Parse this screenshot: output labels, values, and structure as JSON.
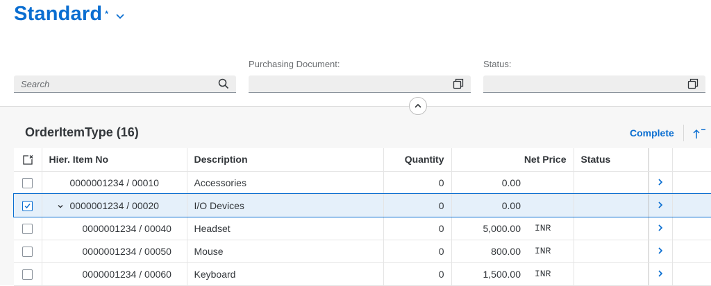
{
  "header": {
    "title": "Standard",
    "modified_marker": "*"
  },
  "filters": {
    "search": {
      "placeholder": "Search",
      "value": ""
    },
    "purchasing_document": {
      "label": "Purchasing Document:",
      "value": ""
    },
    "status": {
      "label": "Status:",
      "value": ""
    }
  },
  "table": {
    "title": "OrderItemType (16)",
    "toolbar": {
      "complete_label": "Complete"
    },
    "columns": {
      "hier_item_no": "Hier. Item No",
      "description": "Description",
      "quantity": "Quantity",
      "net_price": "Net Price",
      "status": "Status"
    },
    "rows": [
      {
        "hier": "0000001234 / 00010",
        "level": 0,
        "expandable": false,
        "description": "Accessories",
        "quantity": "0",
        "net_price": "0.00",
        "currency": "",
        "status": "",
        "selected": false
      },
      {
        "hier": "0000001234 / 00020",
        "level": 0,
        "expandable": true,
        "description": "I/O Devices",
        "quantity": "0",
        "net_price": "0.00",
        "currency": "",
        "status": "",
        "selected": true
      },
      {
        "hier": "0000001234 / 00040",
        "level": 1,
        "expandable": false,
        "description": "Headset",
        "quantity": "0",
        "net_price": "5,000.00",
        "currency": "INR",
        "status": "",
        "selected": false
      },
      {
        "hier": "0000001234 / 00050",
        "level": 1,
        "expandable": false,
        "description": "Mouse",
        "quantity": "0",
        "net_price": "800.00",
        "currency": "INR",
        "status": "",
        "selected": false
      },
      {
        "hier": "0000001234 / 00060",
        "level": 1,
        "expandable": false,
        "description": "Keyboard",
        "quantity": "0",
        "net_price": "1,500.00",
        "currency": "INR",
        "status": "",
        "selected": false
      }
    ]
  },
  "colors": {
    "accent": "#0a6ed1",
    "selected_row": "#e5f0fa",
    "page_bg": "#f7f7f7"
  },
  "icons": {
    "title_dropdown": "chevron-down-icon",
    "search": "search-icon",
    "value_help": "value-help-icon",
    "collapse": "chevron-up-icon",
    "select_all": "select-all-icon",
    "row_nav": "chevron-right-icon",
    "sort": "sort-icon"
  }
}
